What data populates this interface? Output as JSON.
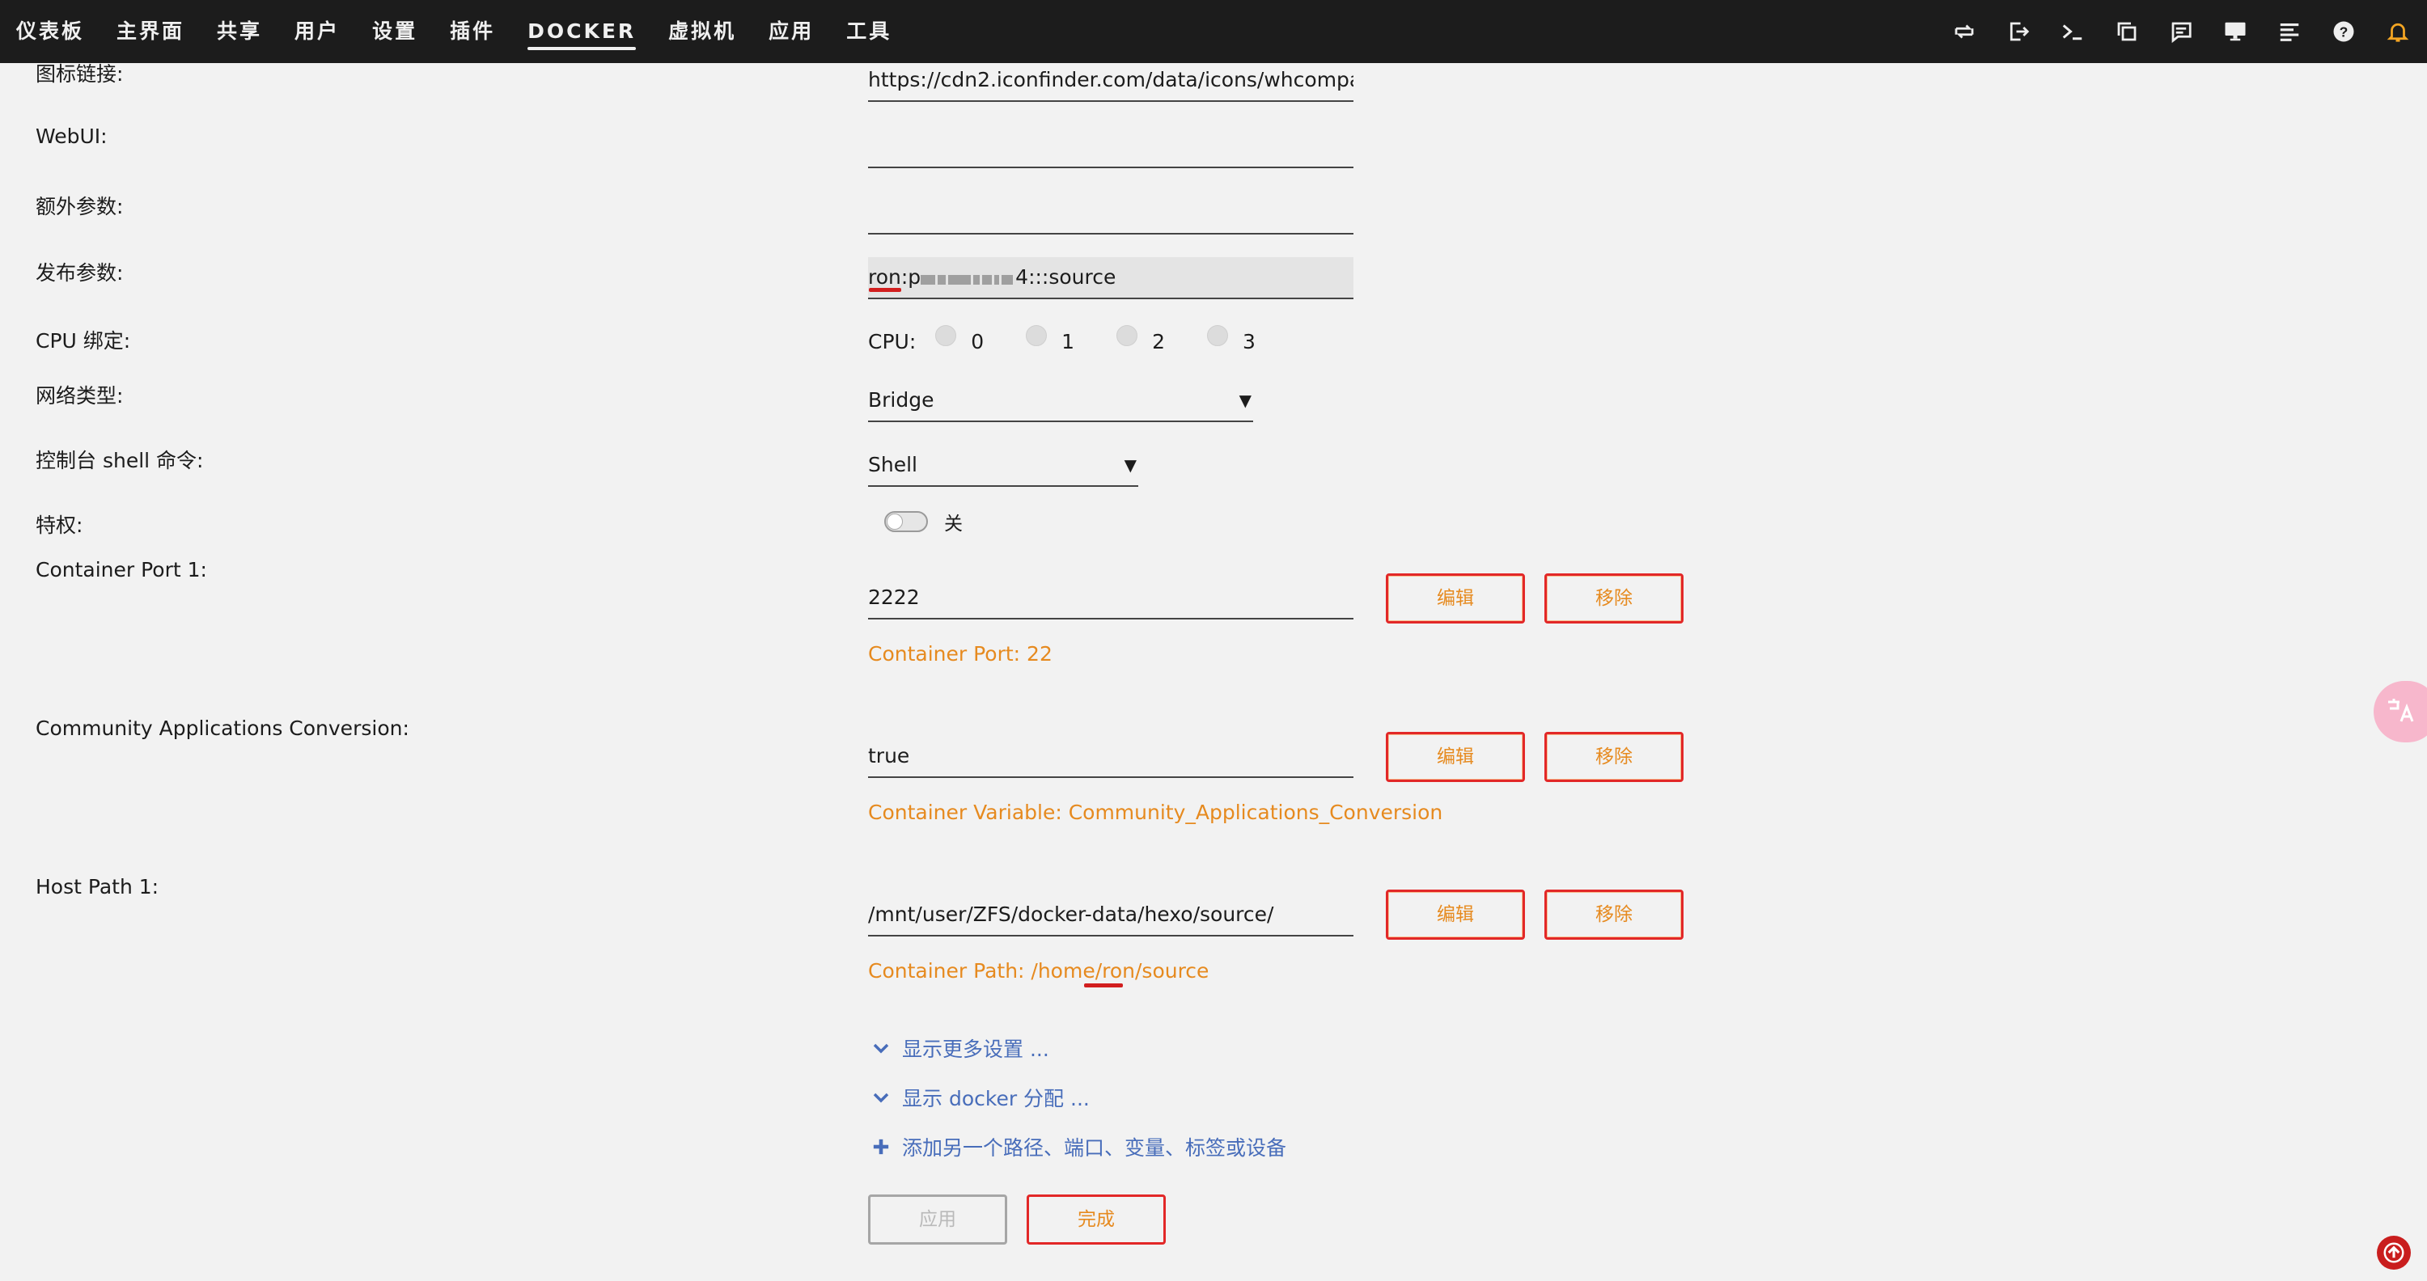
{
  "nav": {
    "items": [
      "仪表板",
      "主界面",
      "共享",
      "用户",
      "设置",
      "插件",
      "DOCKER",
      "虚拟机",
      "应用",
      "工具"
    ],
    "active": "DOCKER",
    "icons": [
      "refresh-icon",
      "logout-icon",
      "terminal-icon",
      "copy-icon",
      "feedback-icon",
      "monitor-icon",
      "log-icon",
      "help-icon",
      "bell-icon"
    ]
  },
  "form": {
    "icon_url": {
      "label": "图标链接:",
      "value": "https://cdn2.iconfinder.com/data/icons/whcompar"
    },
    "webui": {
      "label": "WebUI:",
      "value": ""
    },
    "extra_params": {
      "label": "额外参数:",
      "value": ""
    },
    "post_args": {
      "label": "发布参数:",
      "value_prefix": "ron:p",
      "value_suffix": "4:::source"
    },
    "cpu": {
      "label": "CPU 绑定:",
      "prefix": "CPU:",
      "cores": [
        "0",
        "1",
        "2",
        "3"
      ]
    },
    "network": {
      "label": "网络类型:",
      "value": "Bridge"
    },
    "shell": {
      "label": "控制台 shell 命令:",
      "value": "Shell"
    },
    "privileged": {
      "label": "特权:",
      "state_text": "关"
    },
    "port1": {
      "label": "Container Port 1:",
      "value": "2222",
      "desc": "Container Port: 22"
    },
    "ca_conversion": {
      "label": "Community Applications Conversion:",
      "value": "true",
      "desc": "Container Variable: Community_Applications_Conversion"
    },
    "host_path1": {
      "label": "Host Path 1:",
      "value": "/mnt/user/ZFS/docker-data/hexo/source/",
      "desc": "Container Path: /home/ron/source"
    },
    "edit_label": "编辑",
    "remove_label": "移除"
  },
  "links": {
    "more_settings": "显示更多设置 ...",
    "docker_alloc": "显示 docker 分配 ...",
    "add_another": "添加另一个路径、端口、变量、标签或设备"
  },
  "buttons": {
    "apply": "应用",
    "done": "完成"
  },
  "colors": {
    "accent_orange": "#e68a1f",
    "border_red": "#e22828",
    "link_blue": "#486dba",
    "topbar": "#1c1c1c"
  }
}
